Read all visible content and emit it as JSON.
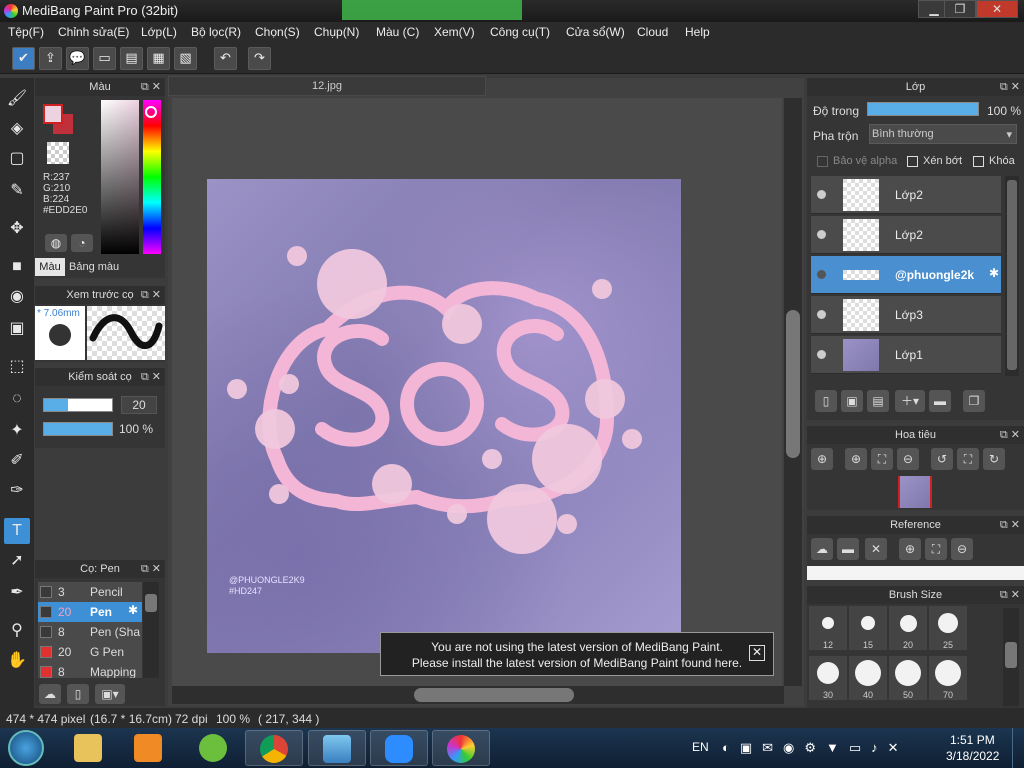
{
  "window": {
    "title": "MediBang Paint Pro (32bit)",
    "minimize": "▁",
    "maximize": "❐",
    "close": "✕"
  },
  "menu": [
    "Tệp(F)",
    "Chỉnh sửa(E)",
    "Lớp(L)",
    "Bộ lọc(R)",
    "Chọn(S)",
    "Chụp(N)",
    "Màu (C)",
    "Xem(V)",
    "Công cụ(T)",
    "Cửa sổ(W)",
    "Cloud",
    "Help"
  ],
  "document": {
    "tab_name": "12.jpg"
  },
  "color_panel": {
    "title": "Màu",
    "r": "R:237",
    "g": "G:210",
    "b": "B:224",
    "hex": "#EDD2E0",
    "tab_color": "Màu",
    "tab_palette": "Bảng màu",
    "fg_color": "#EDD2E0",
    "bg_color": "#c0303a"
  },
  "brush_preview": {
    "title": "Xem trước cọ",
    "size": "7.06mm"
  },
  "brush_control": {
    "title": "Kiểm soát cọ",
    "size_value": "20",
    "opacity_value": "100 %",
    "size_fill": 0.35,
    "opacity_fill": 1.0
  },
  "brush_list": {
    "title": "Cọ: Pen",
    "items": [
      {
        "size": "3",
        "name": "Pencil",
        "color": "#3a3a3a"
      },
      {
        "size": "20",
        "name": "Pen",
        "color": "#3a3a3a",
        "selected": true
      },
      {
        "size": "8",
        "name": "Pen (Sha",
        "color": "#3a3a3a"
      },
      {
        "size": "20",
        "name": "G Pen",
        "color": "#e03030"
      },
      {
        "size": "8",
        "name": "Mapping",
        "color": "#e03030"
      }
    ]
  },
  "layer_panel": {
    "title": "Lớp",
    "opacity_label": "Độ trong",
    "opacity_value": "100 %",
    "opacity_fill": 1.0,
    "blend_label": "Pha trộn",
    "blend_value": "Bình thường",
    "protect_alpha": "Bảo vệ alpha",
    "clipping": "Xén bớt",
    "lock": "Khóa",
    "layers": [
      {
        "name": "Lớp2"
      },
      {
        "name": "Lớp2"
      },
      {
        "name": "@phuongle2k",
        "selected": true
      },
      {
        "name": "Lớp3"
      },
      {
        "name": "Lớp1"
      }
    ]
  },
  "navigator": {
    "title": "Hoa tiêu"
  },
  "reference": {
    "title": "Reference"
  },
  "brush_size": {
    "title": "Brush Size",
    "sizes": [
      "12",
      "15",
      "20",
      "25",
      "30",
      "40",
      "50",
      "70"
    ]
  },
  "notification": {
    "line1": "You are not using the latest version of MediBang Paint.",
    "line2": "Please install the latest version of MediBang Paint found here."
  },
  "artwork": {
    "text": "SoS",
    "watermark1": "@PHUONGLE2K9",
    "watermark2": "#HD247",
    "accent": "#f4b6d6"
  },
  "status": {
    "size_px": "474 * 474 pixel",
    "size_cm": "(16.7 * 16.7cm)",
    "dpi": "72 dpi",
    "zoom": "100 %",
    "coords": "( 217, 344 )"
  },
  "taskbar": {
    "lang": "EN",
    "time": "1:51 PM",
    "date": "3/18/2022"
  }
}
